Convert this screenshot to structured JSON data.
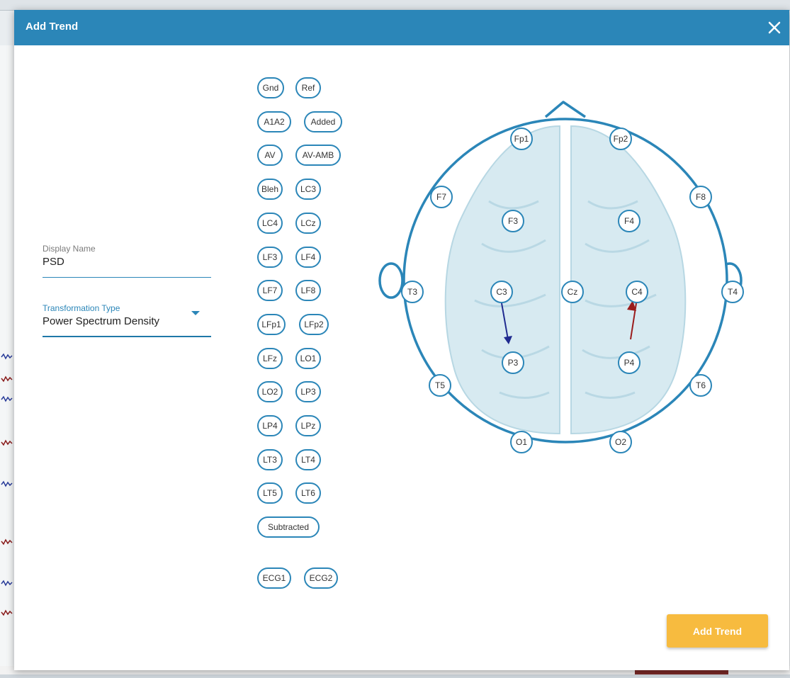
{
  "dialog": {
    "title": "Add Trend",
    "close_icon": "close-icon",
    "submit_label": "Add Trend"
  },
  "form": {
    "display_name_label": "Display Name",
    "display_name_value": "PSD",
    "transformation_label": "Transformation Type",
    "transformation_value": "Power Spectrum Density"
  },
  "channels": [
    "Gnd",
    "Ref",
    "A1A2",
    "Added",
    "AV",
    "AV-AMB",
    "Bleh",
    "LC3",
    "LC4",
    "LCz",
    "LF3",
    "LF4",
    "LF7",
    "LF8",
    "LFp1",
    "LFp2",
    "LFz",
    "LO1",
    "LO2",
    "LP3",
    "LP4",
    "LPz",
    "LT3",
    "LT4",
    "LT5",
    "LT6",
    "Subtracted",
    "ECG1",
    "ECG2"
  ],
  "electrodes": [
    "Fp1",
    "Fp2",
    "F7",
    "F8",
    "F3",
    "F4",
    "T3",
    "C3",
    "Cz",
    "C4",
    "T4",
    "P3",
    "P4",
    "T5",
    "T6",
    "O1",
    "O2"
  ],
  "connections": [
    {
      "from": "C3",
      "to": "P3",
      "color": "#1f2a8f"
    },
    {
      "from": "C4",
      "to": "P4",
      "color": "#9a1c1c"
    }
  ],
  "colors": {
    "header": "#2b86b8",
    "accent": "#2b86b8",
    "button": "#f7bb3f",
    "brain": "#d6e9f0"
  }
}
